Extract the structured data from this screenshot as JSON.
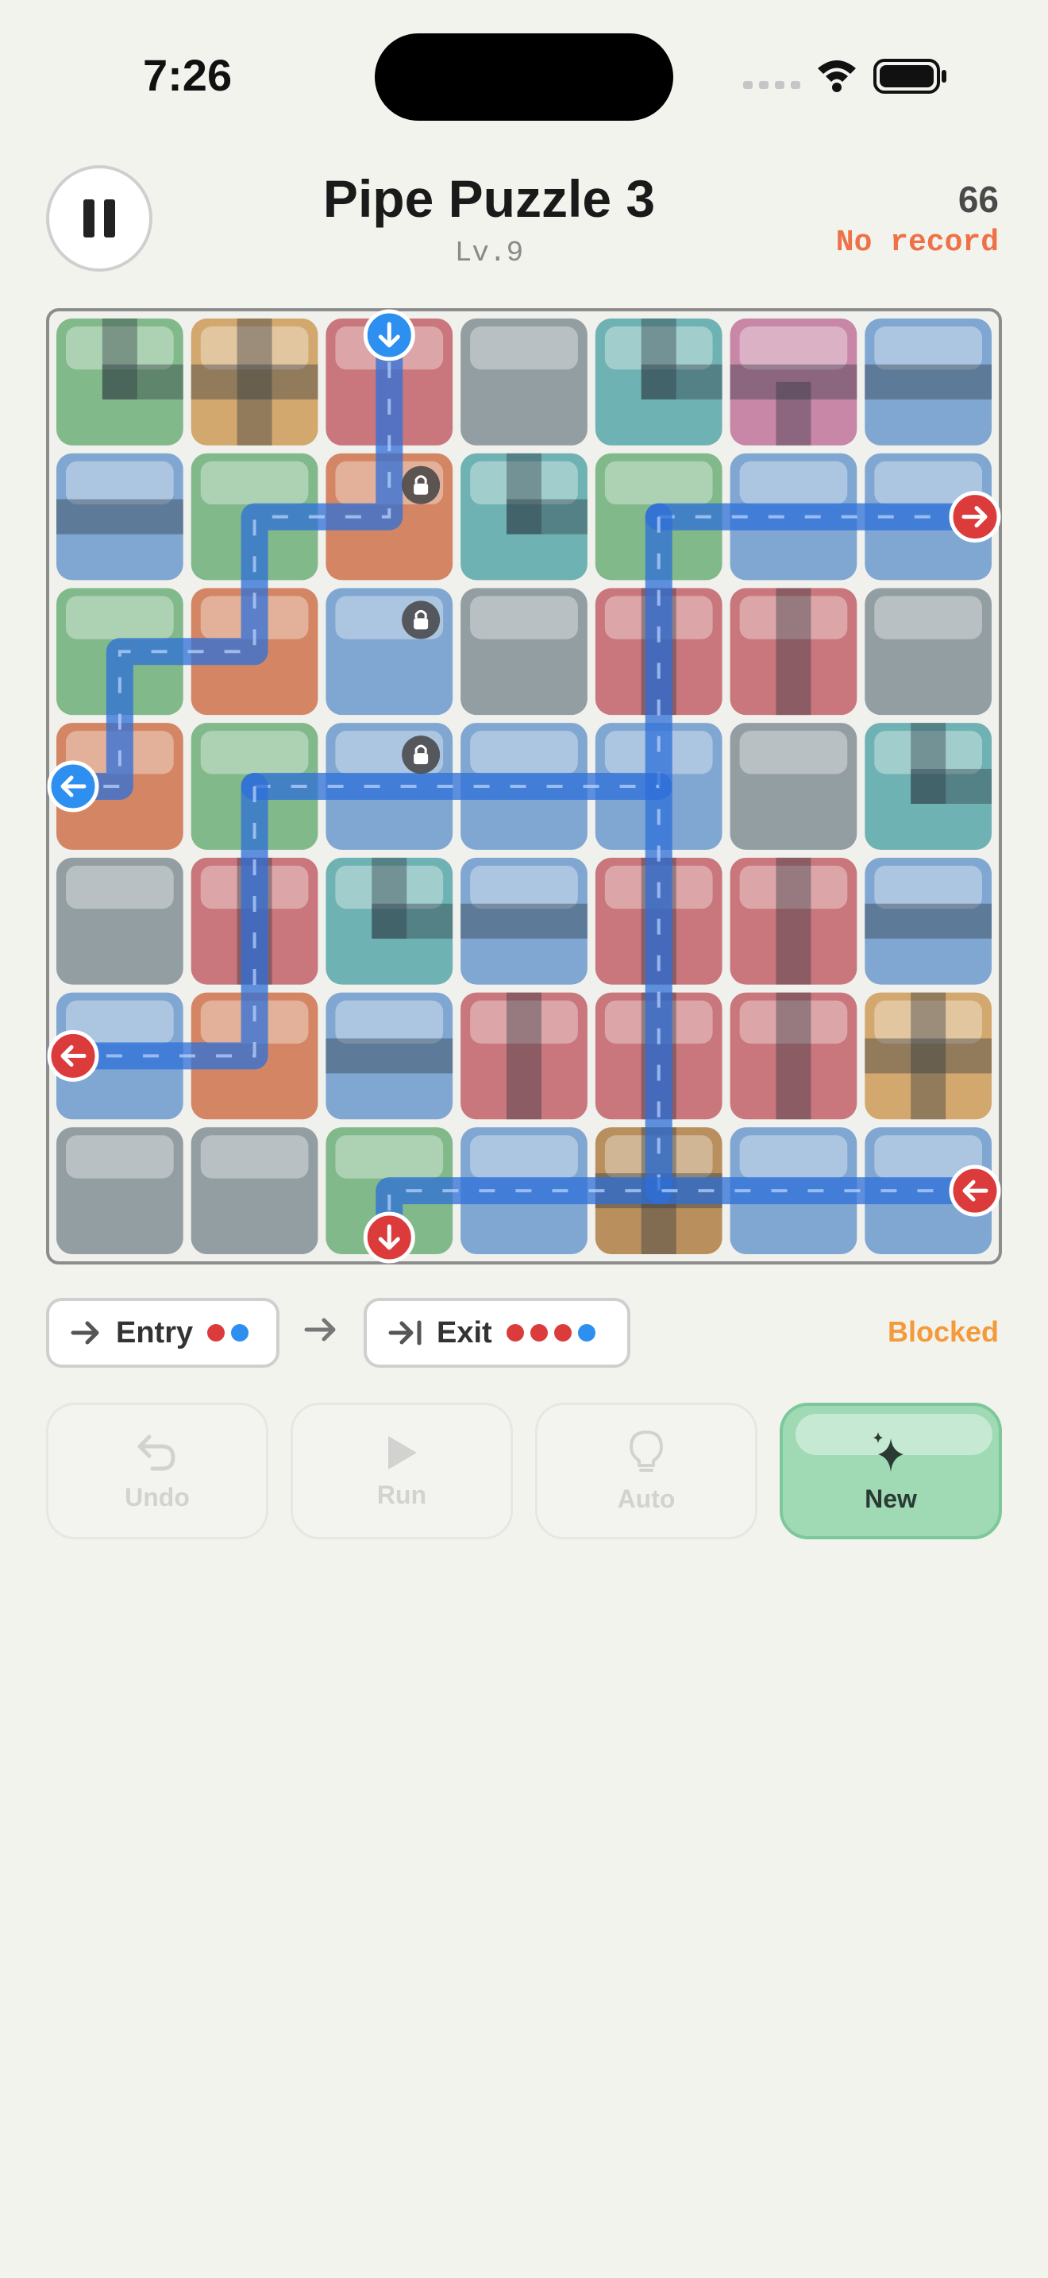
{
  "status_bar": {
    "time": "7:26"
  },
  "header": {
    "title": "Pipe Puzzle 3",
    "level": "Lv.9",
    "score": "66",
    "record": "No record"
  },
  "board": {
    "rows": 7,
    "cols": 7,
    "tiles": [
      [
        "green",
        "tan",
        "red",
        "gray",
        "teal",
        "pink",
        "blue"
      ],
      [
        "blue",
        "green",
        "orange",
        "teal",
        "green",
        "blue",
        "blue"
      ],
      [
        "green",
        "orange",
        "blue",
        "gray",
        "red",
        "red",
        "gray"
      ],
      [
        "orange",
        "green",
        "blue",
        "blue",
        "blue",
        "gray",
        "teal"
      ],
      [
        "gray",
        "red",
        "teal",
        "blue",
        "red",
        "red",
        "blue"
      ],
      [
        "blue",
        "orange",
        "blue",
        "red",
        "red",
        "red",
        "tan"
      ],
      [
        "gray",
        "gray",
        "green",
        "blue",
        "brown",
        "blue",
        "blue"
      ]
    ],
    "locked_cells": [
      [
        1,
        2
      ],
      [
        2,
        2
      ],
      [
        3,
        2
      ]
    ],
    "markers": [
      {
        "label": "entry-top",
        "row": 0,
        "col": 2,
        "side": "top",
        "color": "blue",
        "arrow": "down"
      },
      {
        "label": "exit-right-1",
        "row": 1,
        "col": 6,
        "side": "right",
        "color": "red",
        "arrow": "right"
      },
      {
        "label": "entry-left",
        "row": 3,
        "col": 0,
        "side": "left",
        "color": "blue",
        "arrow": "left"
      },
      {
        "label": "exit-left",
        "row": 5,
        "col": 0,
        "side": "left",
        "color": "red",
        "arrow": "left"
      },
      {
        "label": "exit-right-2",
        "row": 6,
        "col": 6,
        "side": "right",
        "color": "red",
        "arrow": "left"
      },
      {
        "label": "exit-bottom",
        "row": 6,
        "col": 2,
        "side": "bottom",
        "color": "red",
        "arrow": "down"
      }
    ]
  },
  "legend": {
    "entry_label": "Entry",
    "entry_dots": [
      "red",
      "blue"
    ],
    "exit_label": "Exit",
    "exit_dots": [
      "red",
      "red",
      "red",
      "blue"
    ],
    "status": "Blocked"
  },
  "controls": {
    "undo": "Undo",
    "run": "Run",
    "auto": "Auto",
    "new": "New"
  },
  "colors": {
    "green": "#82b98a",
    "tan": "#d3a86e",
    "red": "#c9777c",
    "gray": "#939ea3",
    "teal": "#6fb2b3",
    "pink": "#c887a7",
    "blue": "#80a7d2",
    "orange": "#d48664",
    "brown": "#b98f5e",
    "marker_red": "#dc3b3b",
    "marker_blue": "#2d8ff0",
    "water": "#2d6fd8",
    "accent_new": "#9fdab5",
    "blocked": "#f39a3a"
  }
}
